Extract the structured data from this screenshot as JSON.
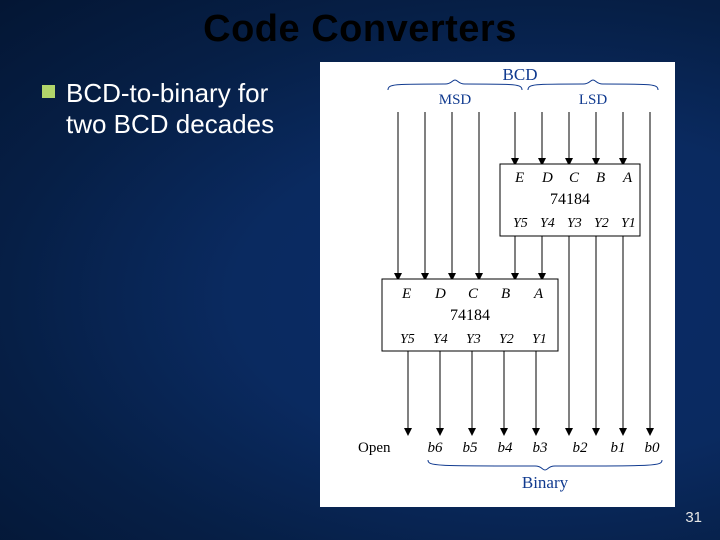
{
  "title": "Code Converters",
  "bullet": "BCD-to-binary for two BCD decades",
  "page": "31",
  "figure": {
    "top_label": "BCD",
    "msd": "MSD",
    "lsd": "LSD",
    "chip": "74184",
    "inputs": [
      "E",
      "D",
      "C",
      "B",
      "A"
    ],
    "outputs": [
      "Y5",
      "Y4",
      "Y3",
      "Y2",
      "Y1"
    ],
    "open": "Open",
    "bits": [
      "b6",
      "b5",
      "b4",
      "b3",
      "b2",
      "b1",
      "b0"
    ],
    "bottom_label": "Binary"
  }
}
